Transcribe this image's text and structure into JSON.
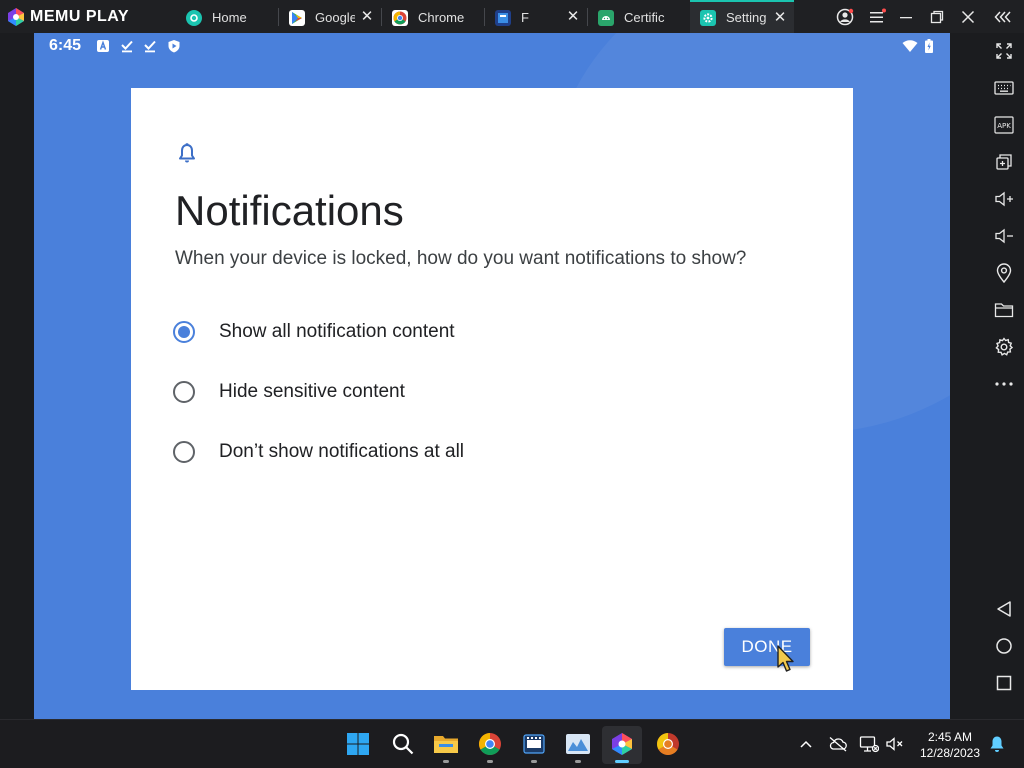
{
  "app": {
    "brand_text": "MEMU PLAY"
  },
  "tabs": [
    {
      "label": "Home",
      "icon": "memu-home-icon",
      "color": "#1bc4b0",
      "closable": false
    },
    {
      "label": "Google",
      "icon": "google-play-icon",
      "color": "#ffffff",
      "closable": true
    },
    {
      "label": "Chrome",
      "icon": "chrome-icon",
      "color": "#ffffff",
      "closable": false
    },
    {
      "label": "F",
      "icon": "file-manager-icon",
      "color": "#3a8ee6",
      "closable": true
    },
    {
      "label": "Certific",
      "icon": "android-icon",
      "color": "#2aa56b",
      "closable": false
    },
    {
      "label": "Setting",
      "icon": "settings-gear-icon",
      "color": "#1bc4b0",
      "closable": true,
      "active": true
    }
  ],
  "statusbar": {
    "time": "6:45"
  },
  "dialog": {
    "title": "Notifications",
    "subtitle": "When your device is locked, how do you want notifications to show?",
    "options": [
      {
        "label": "Show all notification content",
        "selected": true
      },
      {
        "label": "Hide sensitive content",
        "selected": false
      },
      {
        "label": "Don’t show notifications at all",
        "selected": false
      }
    ],
    "done_label": "DONE"
  },
  "taskbar": {
    "time": "2:45 AM",
    "date": "12/28/2023"
  },
  "colors": {
    "accent": "#4a80db",
    "memu_teal": "#1bc4b0",
    "screen_bg": "#4a80db"
  }
}
